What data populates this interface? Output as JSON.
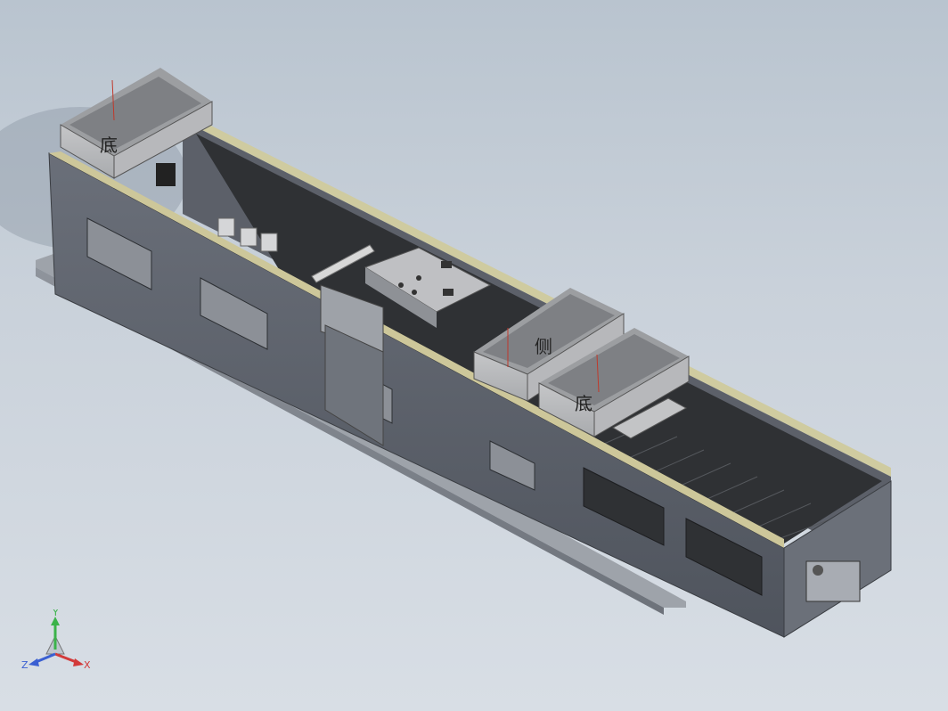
{
  "model": {
    "bin_labels": [
      "底",
      "侧",
      "底"
    ]
  },
  "triad": {
    "y_label": "Y",
    "z_label": "Z",
    "x_label": "X",
    "colors": {
      "x": "#d23a3a",
      "y": "#3bb34a",
      "z": "#3a5fd2"
    }
  }
}
